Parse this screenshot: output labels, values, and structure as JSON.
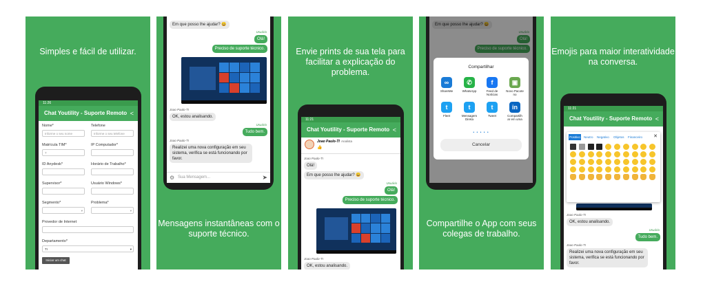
{
  "panels": {
    "p1": {
      "caption": "Simples e fácil de utilizar.",
      "status_time": "11:26",
      "app_title": "Chat Youtility - Suporte Remoto",
      "form": {
        "nome_label": "Nome*",
        "nome_placeholder": "Informe o seu nome",
        "telefone_label": "Telefone",
        "telefone_placeholder": "Informe o seu telefone",
        "matricula_label": "Matrícula TIM*",
        "matricula_value": "T",
        "ip_label": "IP Computador*",
        "anydesk_label": "ID Anydesk*",
        "horario_label": "Horário de Trabalho*",
        "supervisor_label": "Supervisor*",
        "usuario_label": "Usuário Windows*",
        "segmento_label": "Segmento*",
        "problema_label": "Problema*",
        "provedor_label": "Provedor de Internet",
        "departamento_label": "Departamento*",
        "departamento_value": "TI",
        "start_button": "Iniciar um chat"
      }
    },
    "p2": {
      "caption": "Mensagens instantâneas com o suporte técnico.",
      "msg1": "Em que posso lhe ajudar? 😀",
      "user_tag": "Usuário",
      "out1": "Olá!",
      "out2": "Preciso de suporte técnico.",
      "agent_tag": "Joao Paulo-TI",
      "in2": "OK, estou analisando.",
      "user_tag2": "Usuário",
      "out3": "Tudo bem.",
      "agent_tag2": "Joao Paulo-TI",
      "in3": "Realizei uma nova configuração em seu sistema, verifica se está funcionando por favor.",
      "input_placeholder": "Sua Mensagem..."
    },
    "p3": {
      "caption": "Envie prints de sua tela para facilitar a explicação do problema.",
      "status_time": "11:21",
      "app_title": "Chat Youtility - Suporte Remoto",
      "agent_name": "Joao Paulo-TI",
      "agent_role": "Analista",
      "agent_tag": "Joao Paulo-TI",
      "in1": "Olá!",
      "in2": "Em que posso lhe ajudar? 😀",
      "user_tag": "Usuário",
      "out1": "Olá!",
      "out2": "Preciso de suporte técnico.",
      "agent_tag2": "Joao Paulo-TI",
      "in3": "OK, estou analisando."
    },
    "p4": {
      "caption": "Compartilhe o App com seus colegas de trabalho.",
      "msg1": "Em que posso lhe ajudar? 😀",
      "user_tag": "Usuário",
      "out1": "Olá!",
      "out2": "Preciso de suporte técnico.",
      "share_title": "Compartilhar",
      "share_items": [
        "ShareMe",
        "WhatsApp",
        "Feed de Notícias",
        "Novo Pacote no",
        "Fleet",
        "Mensagem Direta",
        "Tweet",
        "Compartilh ar em uma"
      ],
      "cancel": "Cancelar"
    },
    "p5": {
      "caption": "Emojis para maior interatividade na conversa.",
      "status_time": "11:21",
      "app_title": "Chat Youtility - Suporte Remoto",
      "emoji_tabs": [
        "Positivo",
        "Neutro",
        "Negativo",
        "Objetos",
        "Financeiro"
      ],
      "close": "✕",
      "agent_tag": "Joao Paulo-TI",
      "in1": "OK, estou analisando.",
      "user_tag": "Usuário",
      "out1": "Tudo bem.",
      "agent_tag2": "Joao Paulo-TI",
      "in2": "Realizei uma nova configuração em seu sistema, verifica se está funcionando por favor."
    }
  },
  "colors": {
    "brand_green": "#45ab5c",
    "dark_green": "#3a9b4d"
  }
}
